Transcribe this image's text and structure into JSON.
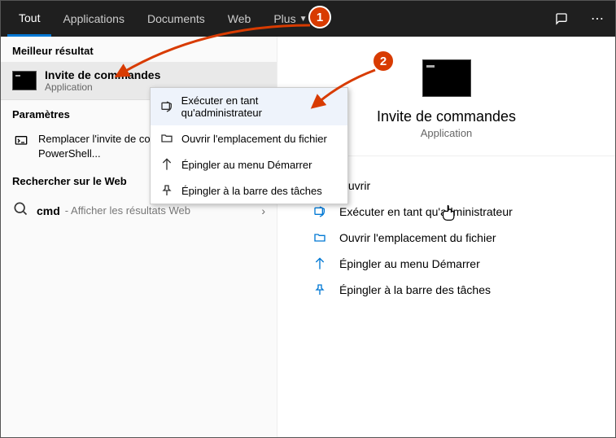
{
  "header": {
    "tabs": [
      {
        "label": "Tout",
        "active": true
      },
      {
        "label": "Applications"
      },
      {
        "label": "Documents"
      },
      {
        "label": "Web"
      },
      {
        "label": "Plus",
        "dropdown": true
      }
    ]
  },
  "left": {
    "best_label": "Meilleur résultat",
    "best_result": {
      "title": "Invite de commandes",
      "subtitle": "Application"
    },
    "params_label": "Paramètres",
    "param_item": "Remplacer l'invite de commandes par Windows PowerShell...",
    "web_label": "Rechercher sur le Web",
    "web_query": "cmd",
    "web_suffix": "- Afficher les résultats Web"
  },
  "context_menu": {
    "items": [
      "Exécuter en tant qu'administrateur",
      "Ouvrir l'emplacement du fichier",
      "Épingler au menu Démarrer",
      "Épingler à la barre des tâches"
    ]
  },
  "right": {
    "title": "Invite de commandes",
    "subtitle": "Application",
    "actions": [
      "Ouvrir",
      "Exécuter en tant qu'administrateur",
      "Ouvrir l'emplacement du fichier",
      "Épingler au menu Démarrer",
      "Épingler à la barre des tâches"
    ]
  },
  "annotations": {
    "badge1": "1",
    "badge2": "2"
  }
}
